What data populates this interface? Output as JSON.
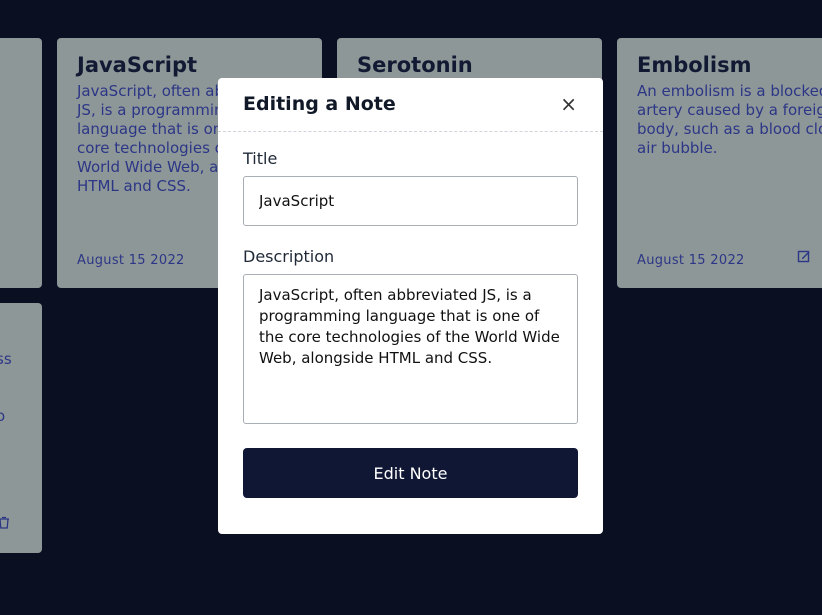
{
  "cards": [
    {
      "title": "JavaScript",
      "description": "JavaScript, often abbreviated JS, is a programming language that is one of the core technologies of the World Wide Web, alongside HTML and CSS.",
      "date": "August 15 2022"
    },
    {
      "title": "Serotonin",
      "description": "",
      "date": ""
    },
    {
      "title": "Embolism",
      "description": "An embolism is a blocked artery caused by a foreign body, such as a blood clot or an air bubble.",
      "date": "August 15 2022"
    }
  ],
  "partial_card": {
    "text_1": "ss",
    "text_2": "o"
  },
  "modal": {
    "title": "Editing a Note",
    "close_symbol": "×",
    "title_label": "Title",
    "title_value": "JavaScript",
    "description_label": "Description",
    "description_value": "JavaScript, often abbreviated JS, is a programming language that is one of the core technologies of the World Wide Web, alongside HTML and CSS.",
    "submit_label": "Edit Note"
  },
  "colors": {
    "background": "#0b0f22",
    "card": "#8e9798",
    "button": "#101734"
  }
}
